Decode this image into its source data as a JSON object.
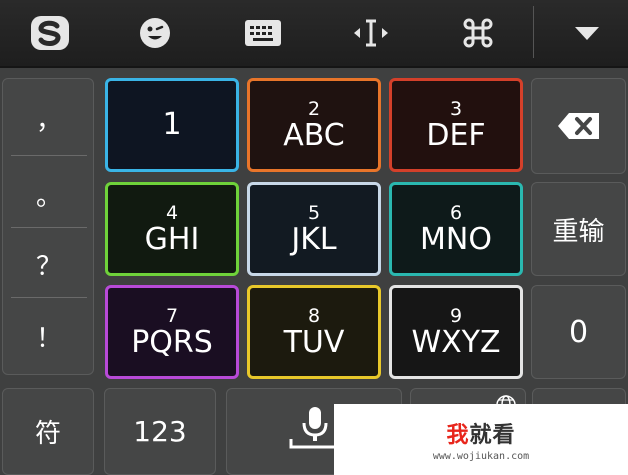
{
  "toolbar": {
    "icons": [
      "sogou-logo-icon",
      "emoji-icon",
      "keyboard-icon",
      "cursor-move-icon",
      "command-icon",
      "collapse-arrow-icon"
    ]
  },
  "punctuation": {
    "items": [
      "，",
      "。",
      "？",
      "！"
    ]
  },
  "keys": [
    {
      "digit": "",
      "letters": "1",
      "border": "#3ab4e6"
    },
    {
      "digit": "2",
      "letters": "ABC",
      "border": "#e8752a"
    },
    {
      "digit": "3",
      "letters": "DEF",
      "border": "#d4402a"
    },
    {
      "digit": "4",
      "letters": "GHI",
      "border": "#6fd23a"
    },
    {
      "digit": "5",
      "letters": "JKL",
      "border": "#c8d8e8"
    },
    {
      "digit": "6",
      "letters": "MNO",
      "border": "#2ab8b0"
    },
    {
      "digit": "7",
      "letters": "PQRS",
      "border": "#b84ad8"
    },
    {
      "digit": "8",
      "letters": "TUV",
      "border": "#e8c82a"
    },
    {
      "digit": "9",
      "letters": "WXYZ",
      "border": "#e4e4e4"
    }
  ],
  "side": {
    "delete_icon": "backspace-icon",
    "reenter": "重输",
    "zero": "0"
  },
  "bottom": {
    "symbols": "符",
    "numbers": "123",
    "space_icon": "microphone-icon",
    "globe_icon": "globe-icon"
  },
  "watermark": {
    "brand_a": "我",
    "brand_b": "就看",
    "url": "www.wojiukan.com"
  }
}
